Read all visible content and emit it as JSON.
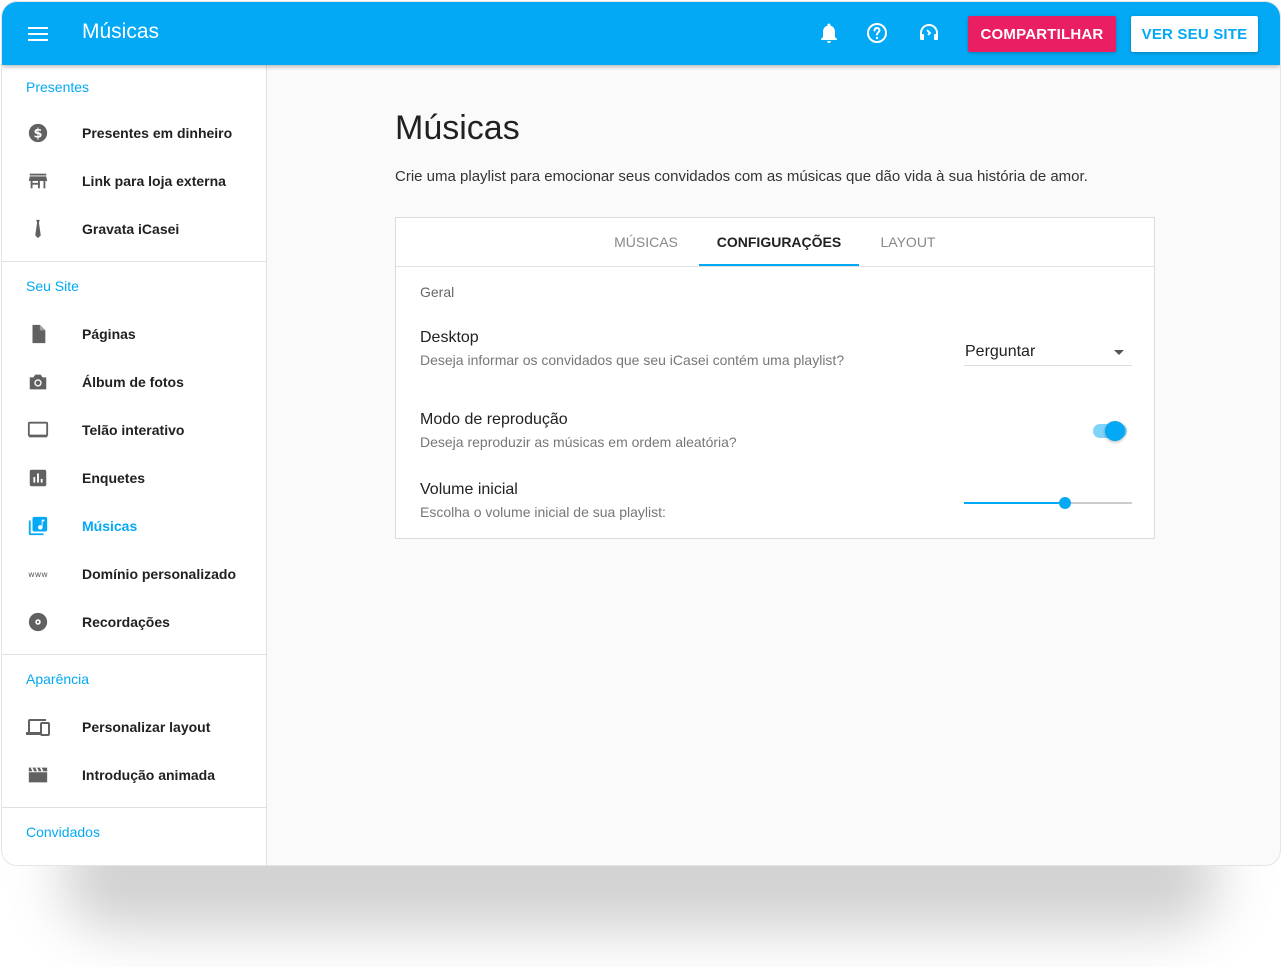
{
  "header": {
    "title": "Músicas",
    "menu_icon": "menu-icon",
    "icons": [
      "bell-icon",
      "help-icon",
      "headset-icon"
    ],
    "share_label": "COMPARTILHAR",
    "site_label": "VER SEU SITE",
    "bar_color": "#03a9f4",
    "share_color": "#e91e63"
  },
  "sidebar": {
    "sections": [
      {
        "title": "Presentes",
        "items": [
          {
            "label": "Presentes em dinheiro",
            "icon": "dollar-icon"
          },
          {
            "label": "Link para loja externa",
            "icon": "store-icon"
          },
          {
            "label": "Gravata iCasei",
            "icon": "tie-icon"
          }
        ]
      },
      {
        "title": "Seu Site",
        "items": [
          {
            "label": "Páginas",
            "icon": "page-icon"
          },
          {
            "label": "Álbum de fotos",
            "icon": "camera-icon"
          },
          {
            "label": "Telão interativo",
            "icon": "screen-icon"
          },
          {
            "label": "Enquetes",
            "icon": "poll-icon"
          },
          {
            "label": "Músicas",
            "icon": "music-library-icon",
            "active": true
          },
          {
            "label": "Domínio personalizado",
            "icon": "www-icon"
          },
          {
            "label": "Recordações",
            "icon": "disc-icon"
          }
        ]
      },
      {
        "title": "Aparência",
        "items": [
          {
            "label": "Personalizar layout",
            "icon": "devices-icon"
          },
          {
            "label": "Introdução animada",
            "icon": "clapperboard-icon"
          }
        ]
      },
      {
        "title": "Convidados",
        "items": []
      }
    ]
  },
  "main": {
    "title": "Músicas",
    "description": "Crie uma playlist para emocionar seus convidados com as músicas que dão vida à sua história de amor.",
    "tabs": [
      {
        "label": "MÚSICAS"
      },
      {
        "label": "CONFIGURAÇÕES",
        "active": true
      },
      {
        "label": "LAYOUT"
      }
    ],
    "group_label": "Geral",
    "settings": {
      "desktop": {
        "title": "Desktop",
        "subtitle": "Deseja informar os convidados que seu iCasei contém uma playlist?",
        "value": "Perguntar"
      },
      "playback": {
        "title": "Modo de reprodução",
        "subtitle": "Deseja reproduzir as músicas em ordem aleatória?",
        "enabled": true
      },
      "volume": {
        "title": "Volume inicial",
        "subtitle": "Escolha o volume inicial de sua playlist:",
        "level": 0.6
      }
    }
  }
}
